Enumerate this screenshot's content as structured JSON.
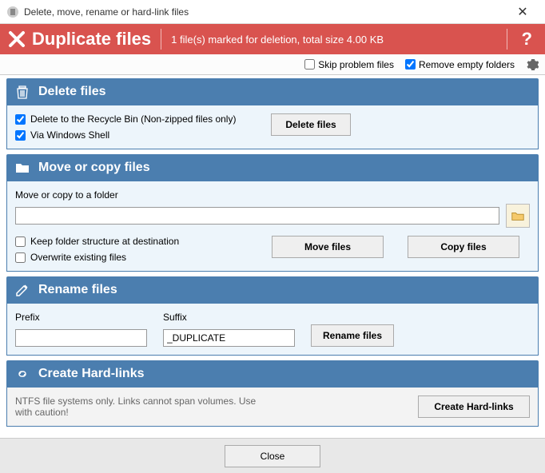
{
  "window": {
    "title": "Delete, move, rename or hard-link files"
  },
  "header": {
    "title": "Duplicate files",
    "status": "1 file(s) marked for deletion, total size 4.00 KB"
  },
  "options": {
    "skip_problem": "Skip problem files",
    "remove_empty": "Remove empty folders"
  },
  "delete": {
    "head": "Delete files",
    "recycle": "Delete to the Recycle Bin (Non-zipped files only)",
    "shell": "Via Windows Shell",
    "button": "Delete files"
  },
  "move": {
    "head": "Move or copy files",
    "label": "Move or copy to a folder",
    "path": "",
    "keep_structure": "Keep folder structure at destination",
    "overwrite": "Overwrite existing files",
    "move_btn": "Move files",
    "copy_btn": "Copy files"
  },
  "rename": {
    "head": "Rename files",
    "prefix_label": "Prefix",
    "suffix_label": "Suffix",
    "prefix": "",
    "suffix": "_DUPLICATE",
    "button": "Rename files"
  },
  "hardlink": {
    "head": "Create Hard-links",
    "note": "NTFS file systems only.  Links cannot span volumes.  Use with caution!",
    "button": "Create Hard-links"
  },
  "footer": {
    "close": "Close"
  }
}
